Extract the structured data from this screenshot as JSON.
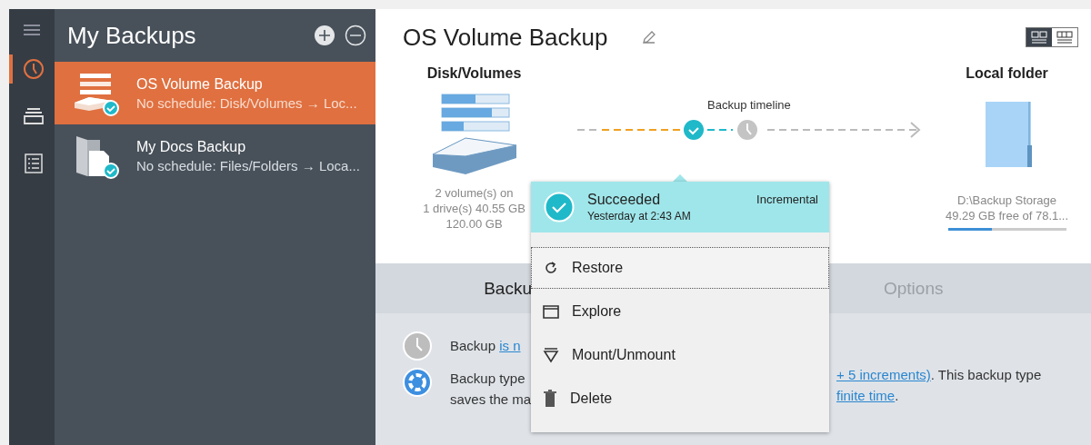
{
  "rail": {
    "items": [
      {
        "selected": true
      },
      {
        "selected": false
      },
      {
        "selected": false
      }
    ]
  },
  "sidebar": {
    "title": "My Backups",
    "items": [
      {
        "kind": "disk",
        "name": "OS Volume Backup",
        "description": "No schedule: Disk/Volumes → Loc...",
        "selected": true
      },
      {
        "kind": "files",
        "name": "My Docs Backup",
        "description": "No schedule: Files/Folders → Loca...",
        "selected": false
      }
    ]
  },
  "main": {
    "title": "OS Volume Backup",
    "view_toggle": [
      {
        "selected": true
      },
      {
        "selected": false
      }
    ],
    "source": {
      "heading": "Disk/Volumes",
      "lines": [
        "2 volume(s) on",
        "1 drive(s) 40.55 GB",
        "120.00 GB"
      ]
    },
    "timeline": {
      "label": "Backup timeline"
    },
    "destination": {
      "heading": "Local folder",
      "path": "D:\\Backup Storage",
      "free": "49.29 GB free of 78.1...",
      "level": 0.37
    }
  },
  "popup": {
    "status": "Succeeded",
    "time": "Yesterday at 2:43 AM",
    "type": "Incremental",
    "items": [
      {
        "kind": "restore",
        "label": "Restore",
        "selected": true
      },
      {
        "kind": "explore",
        "label": "Explore",
        "selected": false
      },
      {
        "kind": "mount",
        "label": "Mount/Unmount",
        "selected": false
      },
      {
        "kind": "delete",
        "label": "Delete",
        "selected": false
      }
    ]
  },
  "bottom": {
    "tabs": [
      {
        "label": "Backu",
        "selected": true
      },
      {
        "label": "Options",
        "selected": false
      }
    ],
    "schedule": {
      "text": "Backup",
      "link": "is n"
    },
    "type_left": [
      "Backup type",
      "saves the ma"
    ],
    "type_right": {
      "link1": "+ 5 increments)",
      "text1": ". This backup type",
      "link2": "finite time",
      "text2": "."
    }
  }
}
